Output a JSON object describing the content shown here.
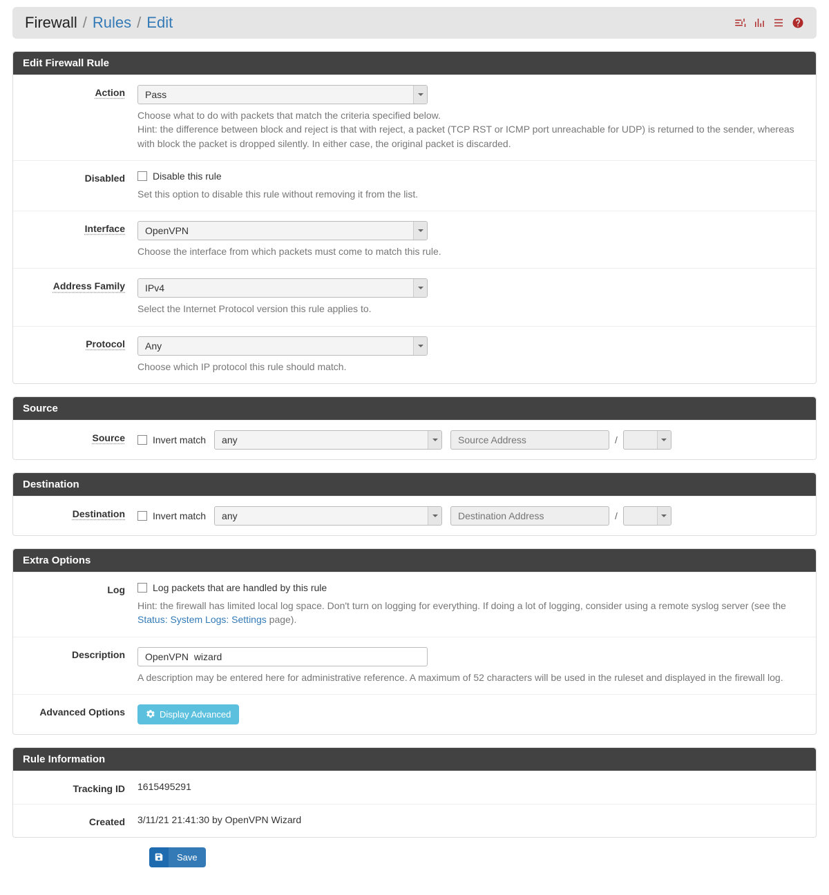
{
  "breadcrumb": {
    "root": "Firewall",
    "mid": "Rules",
    "leaf": "Edit"
  },
  "panels": {
    "edit": "Edit Firewall Rule",
    "source": "Source",
    "destination": "Destination",
    "extra": "Extra Options",
    "info": "Rule Information"
  },
  "labels": {
    "action": "Action",
    "disabled": "Disabled",
    "interface": "Interface",
    "address_family": "Address Family",
    "protocol": "Protocol",
    "source": "Source",
    "destination": "Destination",
    "log": "Log",
    "description": "Description",
    "advanced": "Advanced Options",
    "tracking_id": "Tracking ID",
    "created": "Created"
  },
  "fields": {
    "action": {
      "value": "Pass"
    },
    "disabled": {
      "checkbox_label": "Disable this rule"
    },
    "interface": {
      "value": "OpenVPN"
    },
    "address_family": {
      "value": "IPv4"
    },
    "protocol": {
      "value": "Any"
    },
    "source": {
      "invert_label": "Invert match",
      "type": "any",
      "placeholder": "Source Address",
      "mask": ""
    },
    "destination": {
      "invert_label": "Invert match",
      "type": "any",
      "placeholder": "Destination Address",
      "mask": ""
    },
    "log": {
      "checkbox_label": "Log packets that are handled by this rule"
    },
    "description": {
      "value": "OpenVPN  wizard"
    },
    "advanced_button": "Display Advanced",
    "tracking_id": "1615495291",
    "created": "3/11/21 21:41:30 by OpenVPN Wizard"
  },
  "help": {
    "action1": "Choose what to do with packets that match the criteria specified below.",
    "action2": "Hint: the difference between block and reject is that with reject, a packet (TCP RST or ICMP port unreachable for UDP) is returned to the sender, whereas with block the packet is dropped silently. In either case, the original packet is discarded.",
    "disabled": "Set this option to disable this rule without removing it from the list.",
    "interface": "Choose the interface from which packets must come to match this rule.",
    "address_family": "Select the Internet Protocol version this rule applies to.",
    "protocol": "Choose which IP protocol this rule should match.",
    "log_pre": "Hint: the firewall has limited local log space. Don't turn on logging for everything. If doing a lot of logging, consider using a remote syslog server (see the ",
    "log_link": "Status: System Logs: Settings",
    "log_post": " page).",
    "description": "A description may be entered here for administrative reference. A maximum of 52 characters will be used in the ruleset and displayed in the firewall log."
  },
  "buttons": {
    "save": "Save"
  }
}
